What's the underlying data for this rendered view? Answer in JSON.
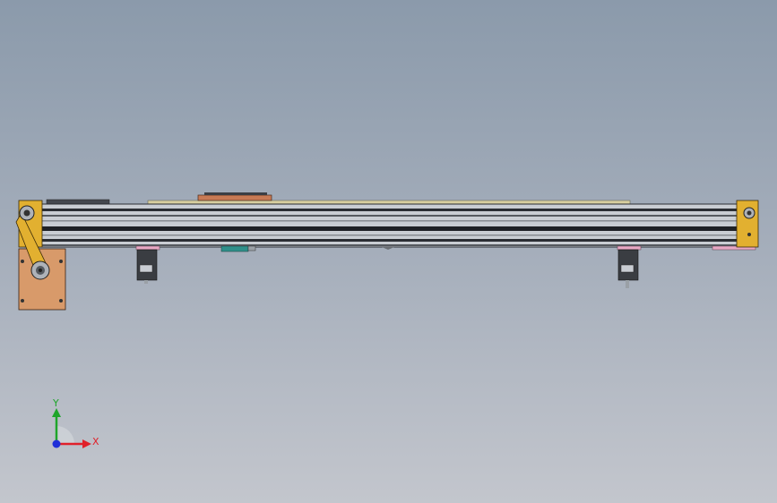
{
  "triad": {
    "x_label": "X",
    "y_label": "Y",
    "x_color": "#e0202a",
    "y_color": "#1ea52a",
    "z_color": "#1f2fd8"
  },
  "colors": {
    "background_top": "#8b9aab",
    "background_bottom": "#c3c6cd",
    "rail": "#c9cdd3",
    "rail_dark": "#2a2d33",
    "end_plate": "#e2b030",
    "motor_plate": "#d89a6a",
    "motor_body": "#3a3d42",
    "carriage": "#c87a55",
    "top_strip": "#d8cfa0",
    "pink_pad": "#e8a8c4",
    "teal_part": "#2f8f8a"
  }
}
